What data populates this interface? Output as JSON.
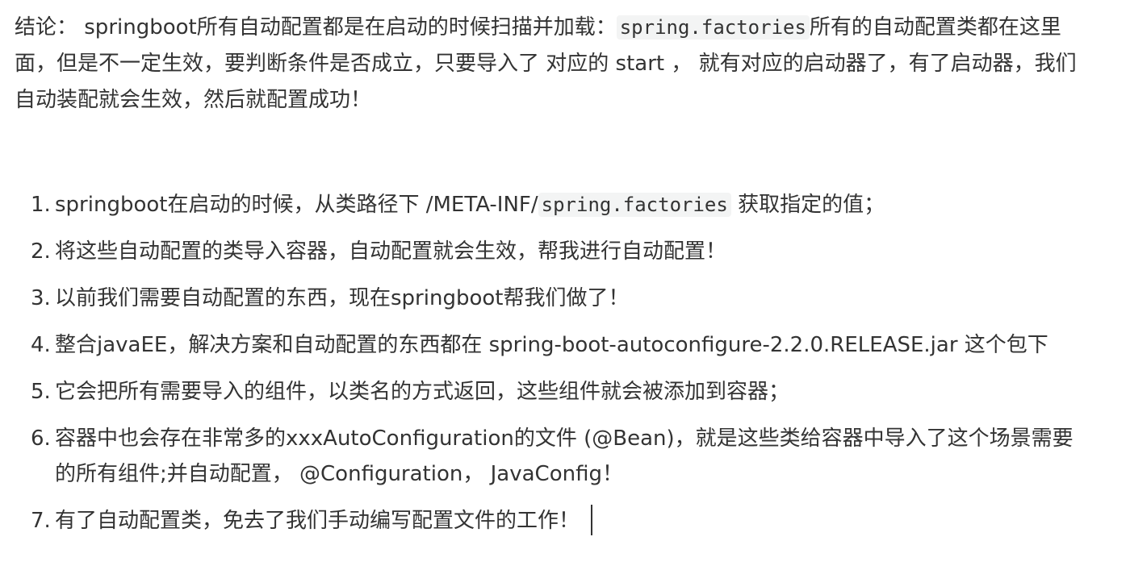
{
  "conclusion": {
    "line1_part1": "结论： springboot所有自动配置都是在启动的时候扫描并加载：",
    "line1_code": "spring.factories",
    "line1_part2": "所有的自动配置类都在这里",
    "line2": "面，但是不一定生效，要判断条件是否成立，只要导入了 对应的 start ， 就有对应的启动器了，有了启动器，我们",
    "line3": "自动装配就会生效，然后就配置成功！"
  },
  "items": [
    {
      "num": "1.",
      "text_before": "springboot在启动的时候，从类路径下 /META-INF/",
      "code": "spring.factories",
      "text_after": " 获取指定的值；"
    },
    {
      "num": "2.",
      "text": "将这些自动配置的类导入容器，自动配置就会生效，帮我进行自动配置！"
    },
    {
      "num": "3.",
      "text": "以前我们需要自动配置的东西，现在springboot帮我们做了！"
    },
    {
      "num": "4.",
      "text": "整合javaEE，解决方案和自动配置的东西都在 spring-boot-autoconfigure-2.2.0.RELEASE.jar 这个包下"
    },
    {
      "num": "5.",
      "text": "它会把所有需要导入的组件，以类名的方式返回，这些组件就会被添加到容器；"
    },
    {
      "num": "6.",
      "text": "容器中也会存在非常多的xxxAutoConfiguration的文件 (@Bean)，就是这些类给容器中导入了这个场景需要",
      "text_wrap": "的所有组件;并自动配置， @Configuration， JavaConfig！"
    },
    {
      "num": "7.",
      "text": "有了自动配置类，免去了我们手动编写配置文件的工作！"
    }
  ]
}
